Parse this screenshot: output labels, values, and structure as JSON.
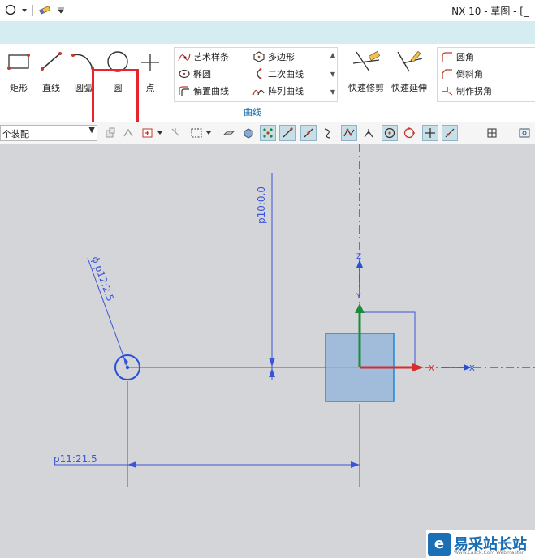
{
  "window": {
    "title": "NX 10 - 草图 - [_"
  },
  "quick_access": {
    "icons": [
      "circle-icon",
      "chevron-down-icon",
      "eraser-icon",
      "chevron-down-icon"
    ]
  },
  "ribbon": {
    "big_buttons": [
      {
        "label": "矩形",
        "icon": "rectangle-icon"
      },
      {
        "label": "直线",
        "icon": "line-icon"
      },
      {
        "label": "圆弧",
        "icon": "arc-icon"
      },
      {
        "label": "圆",
        "icon": "circle-icon"
      },
      {
        "label": "点",
        "icon": "point-icon"
      }
    ],
    "curve_col1": [
      {
        "label": "艺术样条",
        "icon": "studio-spline-icon"
      },
      {
        "label": "椭圆",
        "icon": "ellipse-icon"
      },
      {
        "label": "偏置曲线",
        "icon": "offset-curve-icon"
      }
    ],
    "curve_col2": [
      {
        "label": "多边形",
        "icon": "polygon-icon"
      },
      {
        "label": "二次曲线",
        "icon": "conic-icon"
      },
      {
        "label": "阵列曲线",
        "icon": "pattern-curve-icon"
      }
    ],
    "group_label": "曲线",
    "edit_buttons": [
      {
        "label": "快速修剪",
        "icon": "quick-trim-icon"
      },
      {
        "label": "快速延伸",
        "icon": "quick-extend-icon"
      }
    ],
    "corner_col": [
      {
        "label": "圆角",
        "icon": "fillet-icon"
      },
      {
        "label": "倒斜角",
        "icon": "chamfer-icon"
      },
      {
        "label": "制作拐角",
        "icon": "make-corner-icon"
      }
    ]
  },
  "toolbar2": {
    "filter_value": "个装配"
  },
  "colors": {
    "accent": "#1a6ea8",
    "highlight": "#e8232b",
    "sketch": "#3b55d8",
    "canvas": "#d3d5d9"
  },
  "sketch": {
    "dim_diameter": "ϕ p12:2.5",
    "dim_vertical": "p10:0.0",
    "dim_horizontal": "p11:21.5",
    "axis_x": "X",
    "axis_y": "Y",
    "axis_z": "Z"
  },
  "watermark": {
    "text": "易采站长站",
    "sub": "Www.Easck.Com  Webmaster",
    "logo_letter": "e"
  }
}
